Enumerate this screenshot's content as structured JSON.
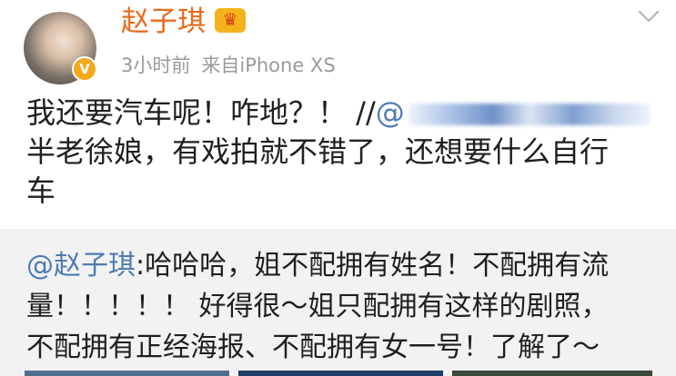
{
  "post": {
    "author": {
      "name": "赵子琪",
      "vip_badge_icon": "crown-icon",
      "verified_icon": "verified-v-icon"
    },
    "time": "3小时前",
    "source": "来自iPhone XS",
    "menu_icon": "chevron-down-icon",
    "body": {
      "line1_text": "我还要汽车呢！咋地？！ //",
      "line1_mention": "@",
      "line2": "半老徐娘，有戏拍就不错了，还想要什么自行",
      "line3": "车"
    }
  },
  "repost": {
    "mention": "@赵子琪",
    "line1_rest": ":哈哈哈，姐不配拥有姓名！不配拥有流",
    "line2": "量！！！！！ 好得很～姐只配拥有这样的剧照，",
    "line3": "不配拥有正经海报、不配拥有女一号！了解了～"
  },
  "colors": {
    "username": "#e96a19",
    "mention": "#4f7bb3",
    "meta": "#9a9a9a",
    "repost_bg": "#f2f2f2",
    "vip_badge": "#f5b31b",
    "verified_badge": "#f2a91b"
  }
}
